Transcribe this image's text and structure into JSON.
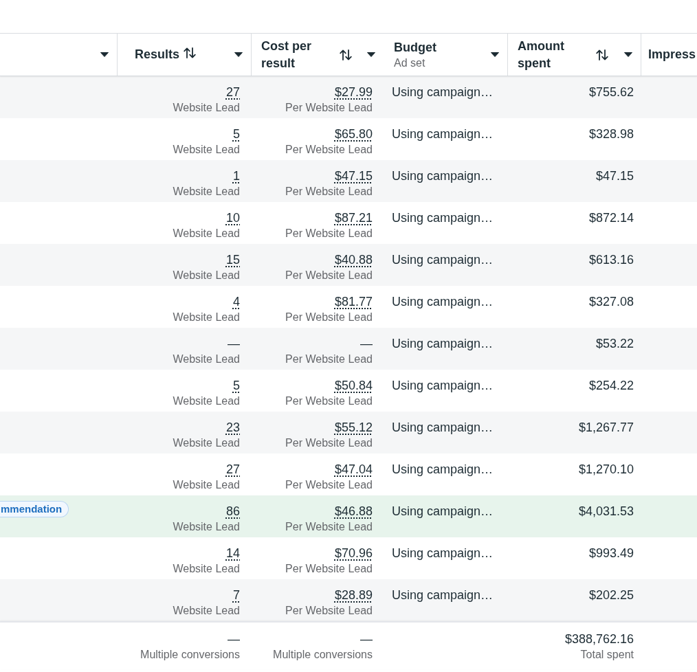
{
  "table": {
    "columns": [
      {
        "menu": true,
        "sortable": false
      },
      {
        "label": "Results",
        "sortable": true,
        "menu": true
      },
      {
        "label": "Cost per result",
        "sortable": true,
        "menu": true
      },
      {
        "label": "Budget",
        "sublabel": "Ad set",
        "sortable": false,
        "menu": true
      },
      {
        "label": "Amount spent",
        "sortable": true,
        "menu": true
      },
      {
        "label": "Impress",
        "sortable": false,
        "menu": false
      }
    ],
    "rows": [
      {
        "results": {
          "value": "27",
          "label": "Website Lead",
          "underlined": true
        },
        "cost_per_result": {
          "value": "$27.99",
          "label": "Per Website Lead",
          "underlined": true
        },
        "budget": "Using campaign…",
        "amount_spent": "$755.62",
        "highlighted": false
      },
      {
        "results": {
          "value": "5",
          "label": "Website Lead",
          "underlined": true
        },
        "cost_per_result": {
          "value": "$65.80",
          "label": "Per Website Lead",
          "underlined": true
        },
        "budget": "Using campaign…",
        "amount_spent": "$328.98",
        "highlighted": false
      },
      {
        "results": {
          "value": "1",
          "label": "Website Lead",
          "underlined": true
        },
        "cost_per_result": {
          "value": "$47.15",
          "label": "Per Website Lead",
          "underlined": true
        },
        "budget": "Using campaign…",
        "amount_spent": "$47.15",
        "highlighted": false
      },
      {
        "results": {
          "value": "10",
          "label": "Website Lead",
          "underlined": true
        },
        "cost_per_result": {
          "value": "$87.21",
          "label": "Per Website Lead",
          "underlined": true
        },
        "budget": "Using campaign…",
        "amount_spent": "$872.14",
        "highlighted": false
      },
      {
        "results": {
          "value": "15",
          "label": "Website Lead",
          "underlined": true
        },
        "cost_per_result": {
          "value": "$40.88",
          "label": "Per Website Lead",
          "underlined": true
        },
        "budget": "Using campaign…",
        "amount_spent": "$613.16",
        "highlighted": false
      },
      {
        "results": {
          "value": "4",
          "label": "Website Lead",
          "underlined": true
        },
        "cost_per_result": {
          "value": "$81.77",
          "label": "Per Website Lead",
          "underlined": true
        },
        "budget": "Using campaign…",
        "amount_spent": "$327.08",
        "highlighted": false
      },
      {
        "results": {
          "value": "—",
          "label": "Website Lead",
          "underlined": false
        },
        "cost_per_result": {
          "value": "—",
          "label": "Per Website Lead",
          "underlined": false
        },
        "budget": "Using campaign…",
        "amount_spent": "$53.22",
        "highlighted": false
      },
      {
        "results": {
          "value": "5",
          "label": "Website Lead",
          "underlined": true
        },
        "cost_per_result": {
          "value": "$50.84",
          "label": "Per Website Lead",
          "underlined": true
        },
        "budget": "Using campaign…",
        "amount_spent": "$254.22",
        "highlighted": false
      },
      {
        "results": {
          "value": "23",
          "label": "Website Lead",
          "underlined": true
        },
        "cost_per_result": {
          "value": "$55.12",
          "label": "Per Website Lead",
          "underlined": true
        },
        "budget": "Using campaign…",
        "amount_spent": "$1,267.77",
        "highlighted": false
      },
      {
        "results": {
          "value": "27",
          "label": "Website Lead",
          "underlined": true
        },
        "cost_per_result": {
          "value": "$47.04",
          "label": "Per Website Lead",
          "underlined": true
        },
        "budget": "Using campaign…",
        "amount_spent": "$1,270.10",
        "highlighted": false
      },
      {
        "badge": "mmendation",
        "results": {
          "value": "86",
          "label": "Website Lead",
          "underlined": true
        },
        "cost_per_result": {
          "value": "$46.88",
          "label": "Per Website Lead",
          "underlined": true
        },
        "budget": "Using campaign…",
        "amount_spent": "$4,031.53",
        "highlighted": true
      },
      {
        "results": {
          "value": "14",
          "label": "Website Lead",
          "underlined": true
        },
        "cost_per_result": {
          "value": "$70.96",
          "label": "Per Website Lead",
          "underlined": true
        },
        "budget": "Using campaign…",
        "amount_spent": "$993.49",
        "highlighted": false
      },
      {
        "results": {
          "value": "7",
          "label": "Website Lead",
          "underlined": true
        },
        "cost_per_result": {
          "value": "$28.89",
          "label": "Per Website Lead",
          "underlined": true
        },
        "budget": "Using campaign…",
        "amount_spent": "$202.25",
        "highlighted": false
      }
    ],
    "total": {
      "results": {
        "value": "—",
        "label": "Multiple conversions"
      },
      "cost_per_result": {
        "value": "—",
        "label": "Multiple conversions"
      },
      "amount_spent": {
        "value": "$388,762.16",
        "label": "Total spent"
      }
    }
  }
}
